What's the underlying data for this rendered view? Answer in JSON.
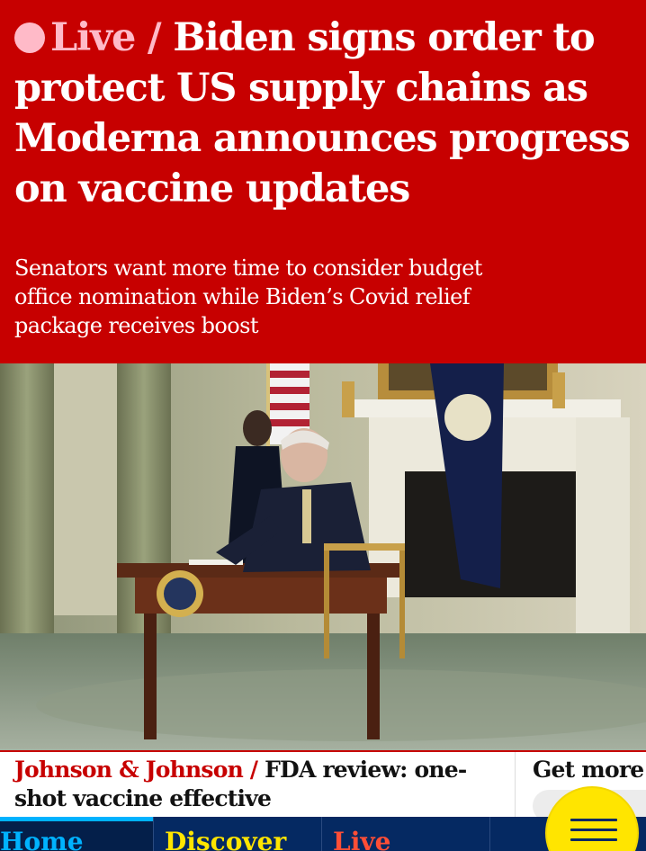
{
  "article": {
    "live_label": "Live",
    "separator": "/",
    "headline": "Biden signs order to protect US supply chains as Moderna announces progress on vaccine updates",
    "standfirst": "Senators want more time to consider budget office nomination while Biden’s Covid relief package receives boost"
  },
  "related": {
    "kicker": "Johnson & Johnson",
    "separator": "/",
    "title": "FDA review: one-shot vaccine effective",
    "right_title": "Get more o"
  },
  "nav": {
    "items": [
      {
        "label": "Home",
        "active": true
      },
      {
        "label": "Discover",
        "active": false
      },
      {
        "label": "Live",
        "active": false
      }
    ]
  },
  "menu": {
    "icon": "hamburger-menu-icon"
  },
  "colors": {
    "header_bg": "#c70000",
    "live_pink": "#ffbac8",
    "nav_bg": "#052962",
    "home_blue": "#00b2ff",
    "discover_yellow": "#ffe500",
    "live_red": "#ff4e36",
    "menu_yellow": "#ffe500"
  }
}
